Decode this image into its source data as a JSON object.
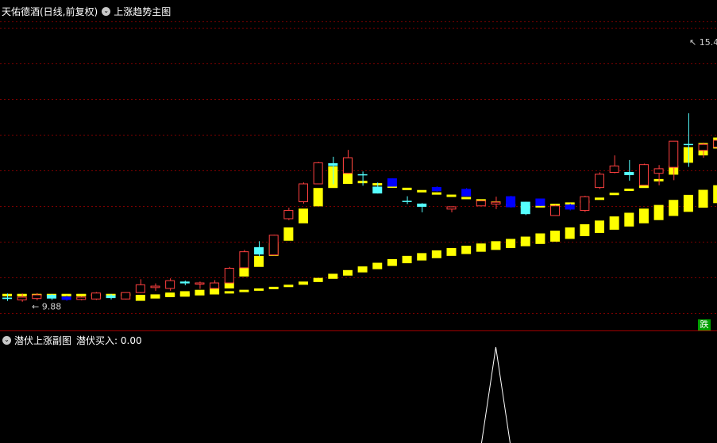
{
  "header": {
    "stock_label": "天佑德酒(日线,前复权)",
    "indicator_label": "上涨趋势主图",
    "dropdown_glyph": "⌄"
  },
  "subpanel": {
    "indicator_label": "潜伏上涨副图",
    "value_label": "潜伏买入: 0.00",
    "dropdown_glyph": "⌄"
  },
  "badge": {
    "label": "跌"
  },
  "colors": {
    "background": "#000000",
    "grid": "#7a0000",
    "border": "#a00000",
    "up_candle": "#ff4040",
    "down_solid": "#0000ff",
    "down_light": "#55ffff",
    "band": "#ffff00",
    "signal": "#ffffff"
  },
  "chart_data": {
    "type": "candlestick",
    "price_range": [
      9.3,
      15.9
    ],
    "annotations": {
      "low": "9.88",
      "high": "15.4"
    },
    "candles": [
      {
        "o": 9.93,
        "h": 10.02,
        "l": 9.86,
        "c": 9.9,
        "color": "down_light"
      },
      {
        "o": 9.94,
        "h": 10.02,
        "l": 9.84,
        "c": 9.88,
        "color": "up"
      },
      {
        "o": 9.91,
        "h": 10.03,
        "l": 9.87,
        "c": 9.99,
        "color": "up"
      },
      {
        "o": 9.99,
        "h": 10.01,
        "l": 9.88,
        "c": 9.91,
        "color": "down_light"
      },
      {
        "o": 9.95,
        "h": 9.97,
        "l": 9.86,
        "c": 9.88,
        "color": "down_solid"
      },
      {
        "o": 9.89,
        "h": 9.96,
        "l": 9.87,
        "c": 9.94,
        "color": "up"
      },
      {
        "o": 9.9,
        "h": 10.05,
        "l": 9.88,
        "c": 10.03,
        "color": "up"
      },
      {
        "o": 9.98,
        "h": 10.01,
        "l": 9.89,
        "c": 9.92,
        "color": "down_light"
      },
      {
        "o": 9.9,
        "h": 10.04,
        "l": 9.89,
        "c": 10.04,
        "color": "up"
      },
      {
        "o": 10.04,
        "h": 10.33,
        "l": 10.03,
        "c": 10.21,
        "color": "up"
      },
      {
        "o": 10.15,
        "h": 10.24,
        "l": 10.08,
        "c": 10.18,
        "color": "up"
      },
      {
        "o": 10.13,
        "h": 10.35,
        "l": 10.08,
        "c": 10.3,
        "color": "up"
      },
      {
        "o": 10.28,
        "h": 10.3,
        "l": 10.2,
        "c": 10.24,
        "color": "down_light"
      },
      {
        "o": 10.23,
        "h": 10.28,
        "l": 10.12,
        "c": 10.25,
        "color": "up"
      },
      {
        "o": 10.13,
        "h": 10.31,
        "l": 10.12,
        "c": 10.25,
        "color": "up"
      },
      {
        "o": 10.25,
        "h": 10.6,
        "l": 10.24,
        "c": 10.57,
        "color": "up"
      },
      {
        "o": 10.58,
        "h": 10.97,
        "l": 10.58,
        "c": 10.93,
        "color": "up"
      },
      {
        "o": 11.03,
        "h": 11.16,
        "l": 10.83,
        "c": 10.87,
        "color": "down_light"
      },
      {
        "o": 10.86,
        "h": 11.3,
        "l": 10.85,
        "c": 11.29,
        "color": "up"
      },
      {
        "o": 11.65,
        "h": 11.89,
        "l": 11.62,
        "c": 11.83,
        "color": "up"
      },
      {
        "o": 12.02,
        "h": 12.44,
        "l": 11.98,
        "c": 12.41,
        "color": "up"
      },
      {
        "o": 12.41,
        "h": 12.89,
        "l": 12.42,
        "c": 12.87,
        "color": "up"
      },
      {
        "o": 12.86,
        "h": 13.0,
        "l": 12.4,
        "c": 12.8,
        "color": "down_light"
      },
      {
        "o": 12.64,
        "h": 13.15,
        "l": 12.63,
        "c": 12.98,
        "color": "up"
      },
      {
        "o": 12.62,
        "h": 12.68,
        "l": 12.37,
        "c": 12.62,
        "color": "down_light"
      },
      {
        "o": 12.35,
        "h": 12.44,
        "l": 12.2,
        "c": 12.2,
        "color": "down_light"
      },
      {
        "o": 12.53,
        "h": 12.53,
        "l": 12.35,
        "c": 12.35,
        "color": "down_solid"
      },
      {
        "o": 12.04,
        "h": 12.14,
        "l": 11.97,
        "c": 12.03,
        "color": "down_light"
      },
      {
        "o": 11.98,
        "h": 11.99,
        "l": 11.79,
        "c": 11.91,
        "color": "down_light"
      },
      {
        "o": 12.34,
        "h": 12.36,
        "l": 12.24,
        "c": 12.25,
        "color": "down_solid"
      },
      {
        "o": 11.86,
        "h": 11.92,
        "l": 11.79,
        "c": 11.91,
        "color": "up"
      },
      {
        "o": 12.3,
        "h": 12.32,
        "l": 12.14,
        "c": 12.14,
        "color": "down_solid"
      },
      {
        "o": 11.93,
        "h": 12.05,
        "l": 11.93,
        "c": 12.04,
        "color": "up"
      },
      {
        "o": 11.97,
        "h": 12.13,
        "l": 11.86,
        "c": 12.01,
        "color": "up"
      },
      {
        "o": 12.14,
        "h": 12.15,
        "l": 11.89,
        "c": 11.9,
        "color": "down_solid"
      },
      {
        "o": 12.02,
        "h": 12.02,
        "l": 11.73,
        "c": 11.75,
        "color": "down_light"
      },
      {
        "o": 12.09,
        "h": 12.09,
        "l": 11.93,
        "c": 11.93,
        "color": "down_solid"
      },
      {
        "o": 11.72,
        "h": 11.95,
        "l": 11.72,
        "c": 11.93,
        "color": "up"
      },
      {
        "o": 11.96,
        "h": 11.98,
        "l": 11.83,
        "c": 11.85,
        "color": "down_solid"
      },
      {
        "o": 11.83,
        "h": 12.15,
        "l": 11.8,
        "c": 12.13,
        "color": "up"
      },
      {
        "o": 12.33,
        "h": 12.66,
        "l": 12.3,
        "c": 12.62,
        "color": "up"
      },
      {
        "o": 12.66,
        "h": 13.03,
        "l": 12.64,
        "c": 12.8,
        "color": "up"
      },
      {
        "o": 12.67,
        "h": 12.93,
        "l": 12.48,
        "c": 12.6,
        "color": "down_light"
      },
      {
        "o": 12.38,
        "h": 12.85,
        "l": 12.38,
        "c": 12.83,
        "color": "up"
      },
      {
        "o": 12.64,
        "h": 12.82,
        "l": 12.38,
        "c": 12.74,
        "color": "up"
      },
      {
        "o": 12.77,
        "h": 13.05,
        "l": 12.49,
        "c": 13.34,
        "color": "up"
      },
      {
        "o": 13.28,
        "h": 13.95,
        "l": 12.78,
        "c": 13.28,
        "color": "down_light"
      },
      {
        "o": 13.14,
        "h": 13.31,
        "l": 12.98,
        "c": 13.27,
        "color": "up"
      },
      {
        "o": 13.21,
        "h": 13.52,
        "l": 13.21,
        "c": 13.36,
        "color": "up"
      },
      {
        "o": 13.17,
        "h": 13.53,
        "l": 13.12,
        "c": 13.29,
        "color": "up"
      },
      {
        "o": 13.42,
        "h": 14.31,
        "l": 13.37,
        "c": 14.3,
        "color": "up"
      },
      {
        "o": 14.03,
        "h": 14.95,
        "l": 14.01,
        "c": 14.85,
        "color": "up"
      },
      {
        "o": 14.94,
        "h": 15.26,
        "l": 13.99,
        "c": 14.97,
        "color": "down_light"
      },
      {
        "o": 13.96,
        "h": 13.98,
        "l": 13.72,
        "c": 13.94,
        "color": "down_light"
      }
    ],
    "band": [
      {
        "u": 10.0,
        "l": 9.97
      },
      {
        "u": 10.0,
        "l": 9.97
      },
      {
        "u": 10.0,
        "l": 9.97
      },
      {
        "u": 10.0,
        "l": 9.97
      },
      {
        "u": 10.0,
        "l": 9.97
      },
      {
        "u": 10.0,
        "l": 9.97
      },
      {
        "u": 10.0,
        "l": 9.97
      },
      {
        "u": 10.0,
        "l": 9.97
      },
      {
        "u": 10.03,
        "l": 9.97
      },
      {
        "u": 9.95,
        "l": 9.86
      },
      {
        "u": 10.0,
        "l": 9.91
      },
      {
        "u": 10.04,
        "l": 9.94
      },
      {
        "u": 10.07,
        "l": 9.95
      },
      {
        "u": 10.1,
        "l": 9.98
      },
      {
        "u": 10.16,
        "l": 10.04
      },
      {
        "u": 10.27,
        "l": 10.13
      },
      {
        "u": 10.58,
        "l": 10.39
      },
      {
        "u": 10.84,
        "l": 10.6
      },
      {
        "u": 11.12,
        "l": 10.84
      },
      {
        "u": 11.46,
        "l": 11.17
      },
      {
        "u": 11.87,
        "l": 11.55
      },
      {
        "u": 12.32,
        "l": 11.92
      },
      {
        "u": 12.79,
        "l": 12.32
      },
      {
        "u": 12.97,
        "l": 12.41
      },
      {
        "u": 12.45,
        "l": 12.45
      },
      {
        "u": 12.4,
        "l": 12.4
      },
      {
        "u": 12.35,
        "l": 12.35
      },
      {
        "u": 12.3,
        "l": 12.3
      },
      {
        "u": 12.25,
        "l": 12.25
      },
      {
        "u": 12.2,
        "l": 12.2
      },
      {
        "u": 12.15,
        "l": 12.15
      },
      {
        "u": 12.1,
        "l": 12.1
      },
      {
        "u": 12.05,
        "l": 12.05
      },
      {
        "u": 12.0,
        "l": 12.0
      },
      {
        "u": 11.95,
        "l": 11.95
      },
      {
        "u": 11.9,
        "l": 11.9
      },
      {
        "u": 11.92,
        "l": 11.92
      },
      {
        "u": 11.95,
        "l": 11.95
      },
      {
        "u": 11.98,
        "l": 11.98
      },
      {
        "u": 12.02,
        "l": 12.02
      },
      {
        "u": 12.1,
        "l": 12.07
      },
      {
        "u": 12.21,
        "l": 12.17
      },
      {
        "u": 12.3,
        "l": 12.26
      },
      {
        "u": 12.39,
        "l": 12.32
      },
      {
        "u": 12.51,
        "l": 12.47
      },
      {
        "u": 12.81,
        "l": 12.61
      },
      {
        "u": 13.21,
        "l": 12.87
      },
      {
        "u": 13.3,
        "l": 13.03
      },
      {
        "u": 13.42,
        "l": 13.18
      },
      {
        "u": 13.54,
        "l": 13.32
      },
      {
        "u": 13.62,
        "l": 13.41
      },
      {
        "u": 13.95,
        "l": 13.58
      },
      {
        "u": 14.21,
        "l": 13.9
      },
      {
        "u": 14.43,
        "l": 14.09
      }
    ],
    "band2": [
      {
        "u": 10.0,
        "l": 9.97
      },
      {
        "u": 10.0,
        "l": 9.97
      },
      {
        "u": 10.0,
        "l": 9.97
      },
      {
        "u": 10.0,
        "l": 9.97
      },
      {
        "u": 10.0,
        "l": 9.97
      },
      {
        "u": 10.0,
        "l": 9.97
      },
      {
        "u": 10.0,
        "l": 9.97
      },
      {
        "u": 10.0,
        "l": 9.97
      },
      {
        "u": 10.0,
        "l": 9.97
      },
      {
        "u": 9.98,
        "l": 9.95
      },
      {
        "u": 9.99,
        "l": 9.96
      },
      {
        "u": 10.0,
        "l": 9.97
      },
      {
        "u": 10.01,
        "l": 9.98
      },
      {
        "u": 10.02,
        "l": 9.99
      },
      {
        "u": 10.04,
        "l": 10.01
      },
      {
        "u": 10.06,
        "l": 10.03
      },
      {
        "u": 10.09,
        "l": 10.06
      },
      {
        "u": 10.12,
        "l": 10.09
      },
      {
        "u": 10.16,
        "l": 10.12
      },
      {
        "u": 10.21,
        "l": 10.16
      },
      {
        "u": 10.28,
        "l": 10.21
      },
      {
        "u": 10.36,
        "l": 10.27
      },
      {
        "u": 10.45,
        "l": 10.34
      },
      {
        "u": 10.53,
        "l": 10.41
      },
      {
        "u": 10.61,
        "l": 10.48
      },
      {
        "u": 10.69,
        "l": 10.55
      },
      {
        "u": 10.77,
        "l": 10.62
      },
      {
        "u": 10.84,
        "l": 10.68
      },
      {
        "u": 10.9,
        "l": 10.74
      },
      {
        "u": 10.96,
        "l": 10.79
      },
      {
        "u": 11.01,
        "l": 10.84
      },
      {
        "u": 11.06,
        "l": 10.88
      },
      {
        "u": 11.11,
        "l": 10.93
      },
      {
        "u": 11.16,
        "l": 10.97
      },
      {
        "u": 11.21,
        "l": 11.01
      },
      {
        "u": 11.26,
        "l": 11.05
      },
      {
        "u": 11.33,
        "l": 11.1
      },
      {
        "u": 11.39,
        "l": 11.15
      },
      {
        "u": 11.46,
        "l": 11.21
      },
      {
        "u": 11.53,
        "l": 11.27
      },
      {
        "u": 11.61,
        "l": 11.34
      },
      {
        "u": 11.7,
        "l": 11.41
      },
      {
        "u": 11.78,
        "l": 11.48
      },
      {
        "u": 11.87,
        "l": 11.55
      },
      {
        "u": 11.95,
        "l": 11.62
      },
      {
        "u": 12.06,
        "l": 11.71
      },
      {
        "u": 12.17,
        "l": 11.8
      },
      {
        "u": 12.28,
        "l": 11.89
      },
      {
        "u": 12.38,
        "l": 11.99
      },
      {
        "u": 12.49,
        "l": 12.09
      },
      {
        "u": 12.6,
        "l": 12.19
      },
      {
        "u": 12.72,
        "l": 12.3
      },
      {
        "u": 12.84,
        "l": 12.4
      },
      {
        "u": 12.95,
        "l": 12.51
      }
    ],
    "signal": {
      "peak_index": 33,
      "value_range": [
        0,
        1
      ]
    }
  }
}
